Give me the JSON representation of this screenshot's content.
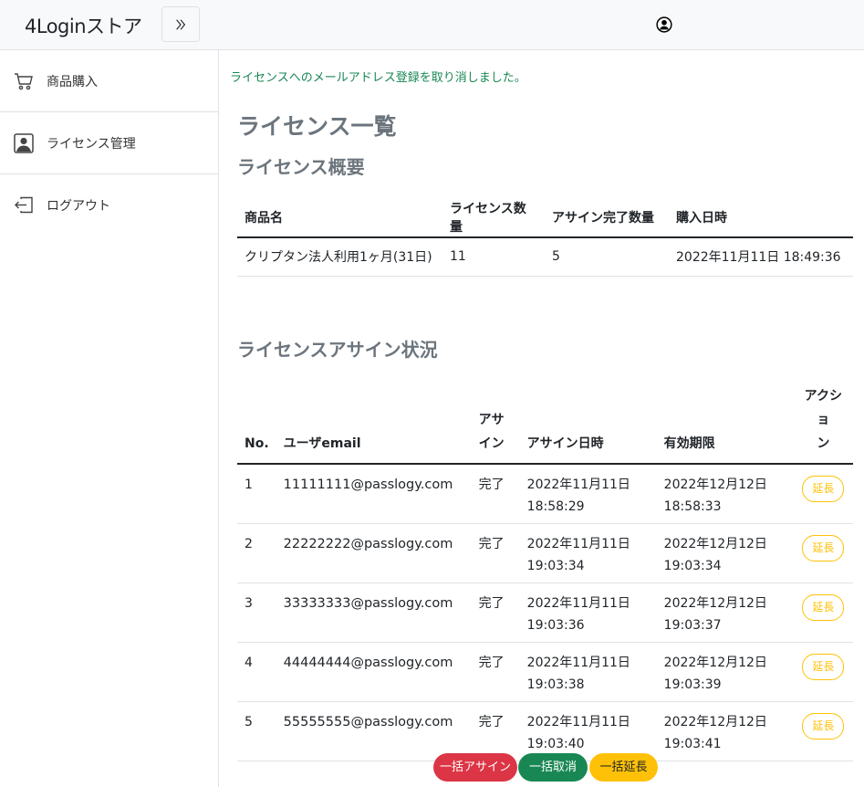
{
  "header": {
    "brand": "4Loginストア",
    "toggle_icon": "chevron-double-right-icon",
    "user_icon": "person-circle-icon"
  },
  "sidebar": {
    "items": [
      {
        "label": "商品購入",
        "icon": "cart-icon"
      },
      {
        "label": "ライセンス管理",
        "icon": "person-square-icon"
      },
      {
        "label": "ログアウト",
        "icon": "box-arrow-left-icon"
      }
    ]
  },
  "main": {
    "alert": "ライセンスへのメールアドレス登録を取り消しました。",
    "title": "ライセンス一覧",
    "summary_title": "ライセンス概要",
    "summary_table": {
      "headers": [
        "商品名",
        "ライセンス数量",
        "アサイン完了数量",
        "購入日時"
      ],
      "rows": [
        [
          "クリプタン法人利用1ヶ月(31日)",
          "11",
          "5",
          "2022年11月11日 18:49:36"
        ]
      ]
    },
    "assign_title": "ライセンスアサイン状況",
    "assign_table": {
      "headers": {
        "no": "No.",
        "email": "ユーザemail",
        "assign_l1": "アサ",
        "assign_l2": "イン",
        "assigned_at": "アサイン日時",
        "expires": "有効期限",
        "action_l1": "アクショ",
        "action_l2": "ン"
      },
      "rows": [
        {
          "no": "1",
          "email": "11111111@passlogy.com",
          "status": "完了",
          "assigned_date": "2022年11月11日",
          "assigned_time": "18:58:29",
          "expire_date": "2022年12月12日",
          "expire_time": "18:58:33",
          "action": "延長"
        },
        {
          "no": "2",
          "email": "22222222@passlogy.com",
          "status": "完了",
          "assigned_date": "2022年11月11日",
          "assigned_time": "19:03:34",
          "expire_date": "2022年12月12日",
          "expire_time": "19:03:34",
          "action": "延長"
        },
        {
          "no": "3",
          "email": "33333333@passlogy.com",
          "status": "完了",
          "assigned_date": "2022年11月11日",
          "assigned_time": "19:03:36",
          "expire_date": "2022年12月12日",
          "expire_time": "19:03:37",
          "action": "延長"
        },
        {
          "no": "4",
          "email": "44444444@passlogy.com",
          "status": "完了",
          "assigned_date": "2022年11月11日",
          "assigned_time": "19:03:38",
          "expire_date": "2022年12月12日",
          "expire_time": "19:03:39",
          "action": "延長"
        },
        {
          "no": "5",
          "email": "55555555@passlogy.com",
          "status": "完了",
          "assigned_date": "2022年11月11日",
          "assigned_time": "19:03:40",
          "expire_date": "2022年12月12日",
          "expire_time": "19:03:41",
          "action": "延長"
        }
      ]
    },
    "bulk_buttons": {
      "assign": "一括アサイン",
      "cancel": "一括取消",
      "extend": "一括延長"
    }
  },
  "colors": {
    "success": "#198754",
    "danger": "#dc3545",
    "warning": "#ffc107",
    "muted": "#6c757d"
  }
}
